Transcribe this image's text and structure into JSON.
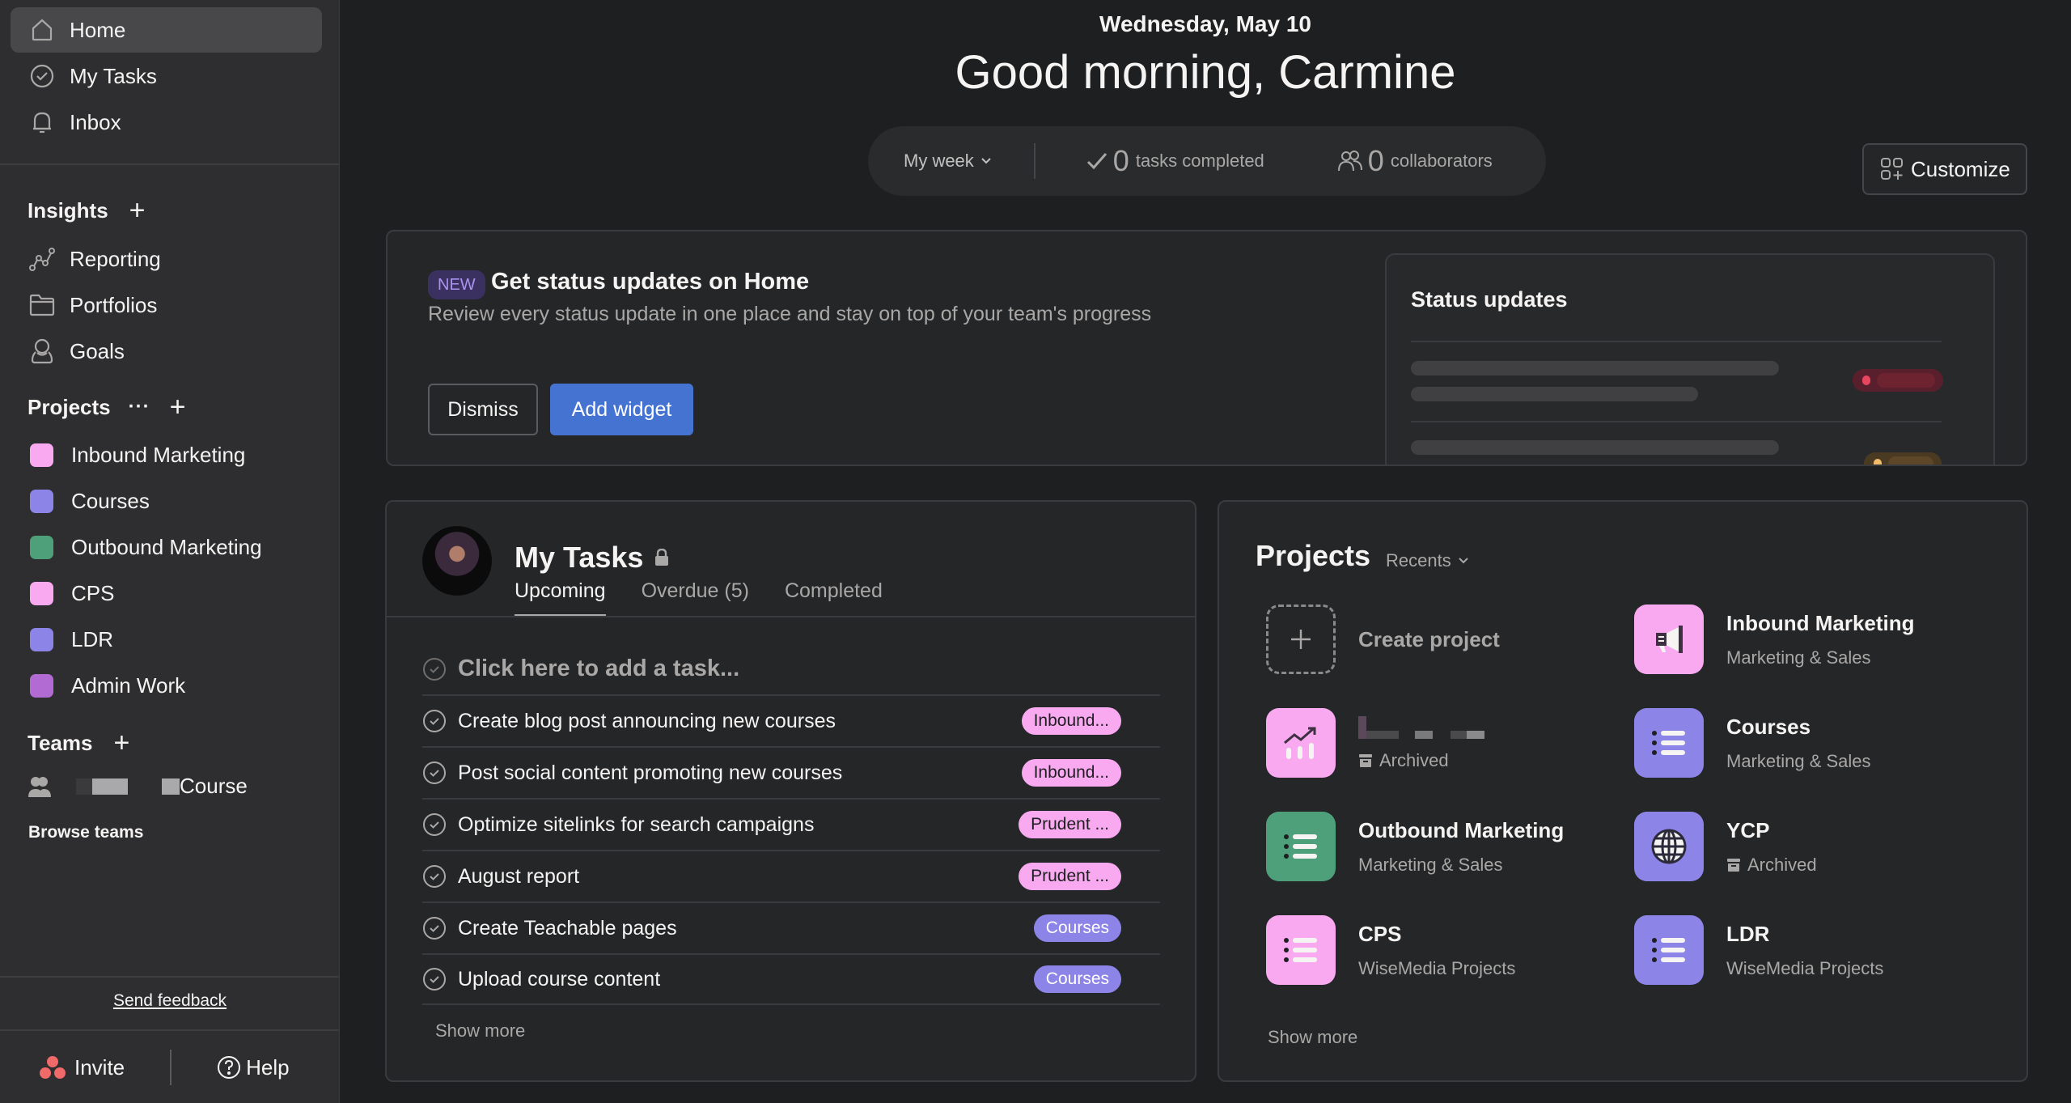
{
  "sidebar": {
    "nav": [
      {
        "label": "Home",
        "icon": "home-icon",
        "active": true
      },
      {
        "label": "My Tasks",
        "icon": "check-circle-icon",
        "active": false
      },
      {
        "label": "Inbox",
        "icon": "bell-icon",
        "active": false
      }
    ],
    "insights": {
      "heading": "Insights",
      "items": [
        {
          "label": "Reporting",
          "icon": "reporting-icon"
        },
        {
          "label": "Portfolios",
          "icon": "folder-icon"
        },
        {
          "label": "Goals",
          "icon": "goals-icon"
        }
      ]
    },
    "projects": {
      "heading": "Projects",
      "more": "···",
      "items": [
        {
          "label": "Inbound Marketing",
          "color": "#f9a9f0"
        },
        {
          "label": "Courses",
          "color": "#8d84e8"
        },
        {
          "label": "Outbound Marketing",
          "color": "#4ea07a"
        },
        {
          "label": "CPS",
          "color": "#f9a9f0"
        },
        {
          "label": "LDR",
          "color": "#8d84e8"
        },
        {
          "label": "Admin Work",
          "color": "#b36bd4"
        }
      ]
    },
    "teams": {
      "heading": "Teams",
      "items": [
        {
          "label": "Course",
          "icon": "team-icon"
        }
      ],
      "browse": "Browse teams"
    },
    "feedback": "Send feedback",
    "invite": "Invite",
    "help": "Help"
  },
  "header": {
    "date": "Wednesday, May 10",
    "greeting": "Good morning, Carmine",
    "period": "My week",
    "tasks_completed_count": "0",
    "tasks_completed_label": "tasks completed",
    "collaborators_count": "0",
    "collaborators_label": "collaborators",
    "customize": "Customize"
  },
  "banner": {
    "badge": "NEW",
    "title": "Get status updates on Home",
    "subtitle": "Review every status update in one place and stay on top of your team's progress",
    "dismiss": "Dismiss",
    "add_widget": "Add widget",
    "preview_title": "Status updates",
    "status_colors": {
      "off_track": "#e8455f",
      "at_risk": "#f1bd6c"
    }
  },
  "my_tasks": {
    "title": "My Tasks",
    "tabs": [
      {
        "label": "Upcoming",
        "active": true
      },
      {
        "label": "Overdue (5)",
        "active": false
      },
      {
        "label": "Completed",
        "active": false
      }
    ],
    "add_placeholder": "Click here to add a task...",
    "tasks": [
      {
        "name": "Create blog post announcing new courses",
        "project": "Inbound...",
        "tag_bg": "#f9a9f0",
        "tag_fg": "#1e1f21"
      },
      {
        "name": "Post social content promoting new courses",
        "project": "Inbound...",
        "tag_bg": "#f9a9f0",
        "tag_fg": "#1e1f21"
      },
      {
        "name": "Optimize sitelinks for search campaigns",
        "project": "Prudent ...",
        "tag_bg": "#f9a9f0",
        "tag_fg": "#1e1f21"
      },
      {
        "name": "August report",
        "project": "Prudent ...",
        "tag_bg": "#f9a9f0",
        "tag_fg": "#1e1f21"
      },
      {
        "name": "Create Teachable pages",
        "project": "Courses",
        "tag_bg": "#8d84e8",
        "tag_fg": "#ffffff"
      },
      {
        "name": "Upload course content",
        "project": "Courses",
        "tag_bg": "#8d84e8",
        "tag_fg": "#ffffff"
      }
    ],
    "show_more": "Show more"
  },
  "projects_widget": {
    "title": "Projects",
    "filter": "Recents",
    "create": "Create project",
    "items": [
      {
        "name": "Inbound Marketing",
        "subtitle": "Marketing & Sales",
        "icon": "megaphone-icon",
        "color": "#f9a9f0",
        "archived": false
      },
      {
        "name": "",
        "subtitle": "Archived",
        "icon": "trend-chart-icon",
        "color": "#f9a9f0",
        "archived": true
      },
      {
        "name": "Courses",
        "subtitle": "Marketing & Sales",
        "icon": "list-icon",
        "color": "#8d84e8",
        "archived": false
      },
      {
        "name": "Outbound Marketing",
        "subtitle": "Marketing & Sales",
        "icon": "list-icon",
        "color": "#4ea07a",
        "archived": false
      },
      {
        "name": "YCP",
        "subtitle": "Archived",
        "icon": "globe-icon",
        "color": "#8d84e8",
        "archived": true
      },
      {
        "name": "CPS",
        "subtitle": "WiseMedia Projects",
        "icon": "list-icon",
        "color": "#f9a9f0",
        "archived": false
      },
      {
        "name": "LDR",
        "subtitle": "WiseMedia Projects",
        "icon": "list-icon",
        "color": "#8d84e8",
        "archived": false
      }
    ],
    "show_more": "Show more"
  }
}
